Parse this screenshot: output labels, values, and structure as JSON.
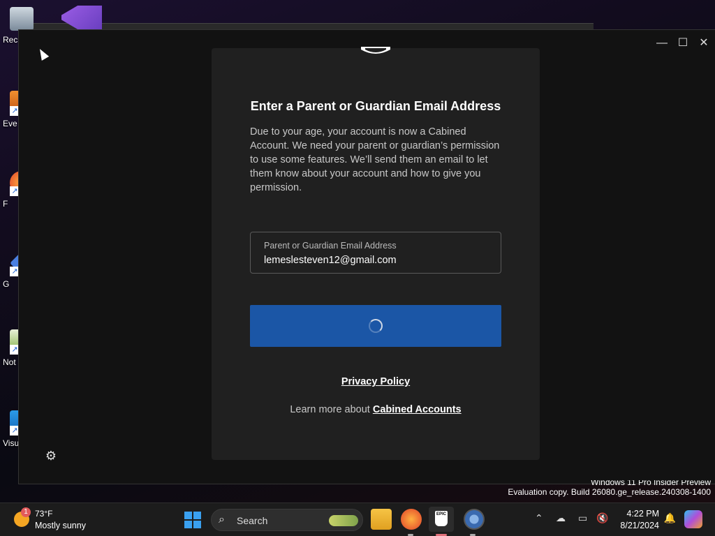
{
  "desktop": {
    "icons": [
      {
        "label": "Rec"
      },
      {
        "label": "Eve"
      },
      {
        "label": "F"
      },
      {
        "label": "G"
      },
      {
        "label": "Not"
      },
      {
        "label": "Visu"
      }
    ]
  },
  "window": {
    "controls": {
      "minimize": "—",
      "maximize": "☐",
      "close": "✕"
    },
    "settings_icon": "⚙"
  },
  "dialog": {
    "title": "Enter a Parent or Guardian Email Address",
    "description": "Due to your age, your account is now a Cabined Account. We need your parent or guardian’s permission to use some features. We’ll send them an email to let them know about your account and how to give you permission.",
    "email_field": {
      "label": "Parent or Guardian Email Address",
      "value": "lemeslesteven12@gmail.com"
    },
    "privacy_link": "Privacy Policy",
    "learn_more_prefix": "Learn more about ",
    "learn_more_link": "Cabined Accounts"
  },
  "watermark": {
    "line1": "Windows 11 Pro Insider Preview",
    "line2": "Evaluation copy. Build 26080.ge_release.240308-1400"
  },
  "taskbar": {
    "weather": {
      "badge": "1",
      "temp": "73°F",
      "condition": "Mostly sunny"
    },
    "search_placeholder": "Search",
    "apps": [
      "file-explorer",
      "firefox",
      "epic-games-launcher",
      "settings"
    ],
    "epic_label": "EPIC",
    "clock": {
      "time": "4:22 PM",
      "date": "8/21/2024"
    },
    "colors": {
      "accent": "#1b56a6",
      "start": "#3aa0f0"
    }
  }
}
